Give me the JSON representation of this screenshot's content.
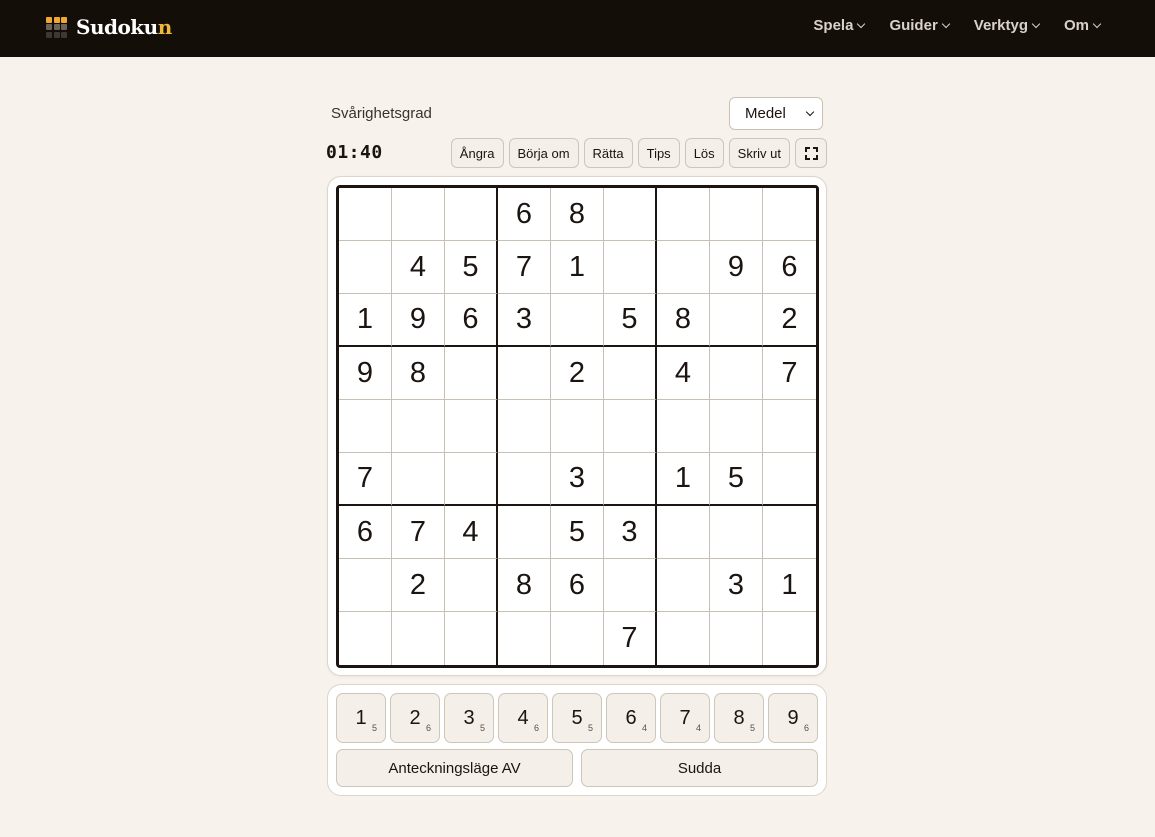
{
  "header": {
    "logo": {
      "text_main": "Sudoku",
      "text_accent": "n",
      "grid_colors": [
        "#f0a830",
        "#f0a830",
        "#f0a830",
        "#6b635b",
        "#6b635b",
        "#6b635b",
        "#3f3832",
        "#3f3832",
        "#3f3832"
      ]
    },
    "nav": [
      {
        "label": "Spela"
      },
      {
        "label": "Guider"
      },
      {
        "label": "Verktyg"
      },
      {
        "label": "Om"
      }
    ]
  },
  "difficulty": {
    "label": "Svårighetsgrad",
    "selected": "Medel"
  },
  "timer": "01:40",
  "toolbar": {
    "undo": "Ångra",
    "restart": "Börja om",
    "check": "Rätta",
    "hint": "Tips",
    "solve": "Lös",
    "print": "Skriv ut",
    "fullscreen_icon": "fullscreen-icon"
  },
  "board": [
    [
      "",
      "",
      "",
      "6",
      "8",
      "",
      "",
      "",
      ""
    ],
    [
      "",
      "4",
      "5",
      "7",
      "1",
      "",
      "",
      "9",
      "6"
    ],
    [
      "1",
      "9",
      "6",
      "3",
      "",
      "5",
      "8",
      "",
      "2"
    ],
    [
      "9",
      "8",
      "",
      "",
      "2",
      "",
      "4",
      "",
      "7"
    ],
    [
      "",
      "",
      "",
      "",
      "",
      "",
      "",
      "",
      ""
    ],
    [
      "7",
      "",
      "",
      "",
      "3",
      "",
      "1",
      "5",
      ""
    ],
    [
      "6",
      "7",
      "4",
      "",
      "5",
      "3",
      "",
      "",
      ""
    ],
    [
      "",
      "2",
      "",
      "8",
      "6",
      "",
      "",
      "3",
      "1"
    ],
    [
      "",
      "",
      "",
      "",
      "",
      "7",
      "",
      "",
      ""
    ]
  ],
  "numpad": [
    {
      "digit": "1",
      "remaining": "5"
    },
    {
      "digit": "2",
      "remaining": "6"
    },
    {
      "digit": "3",
      "remaining": "5"
    },
    {
      "digit": "4",
      "remaining": "6"
    },
    {
      "digit": "5",
      "remaining": "5"
    },
    {
      "digit": "6",
      "remaining": "4"
    },
    {
      "digit": "7",
      "remaining": "4"
    },
    {
      "digit": "8",
      "remaining": "5"
    },
    {
      "digit": "9",
      "remaining": "6"
    }
  ],
  "actions": {
    "notes": "Anteckningsläge AV",
    "erase": "Sudda"
  }
}
